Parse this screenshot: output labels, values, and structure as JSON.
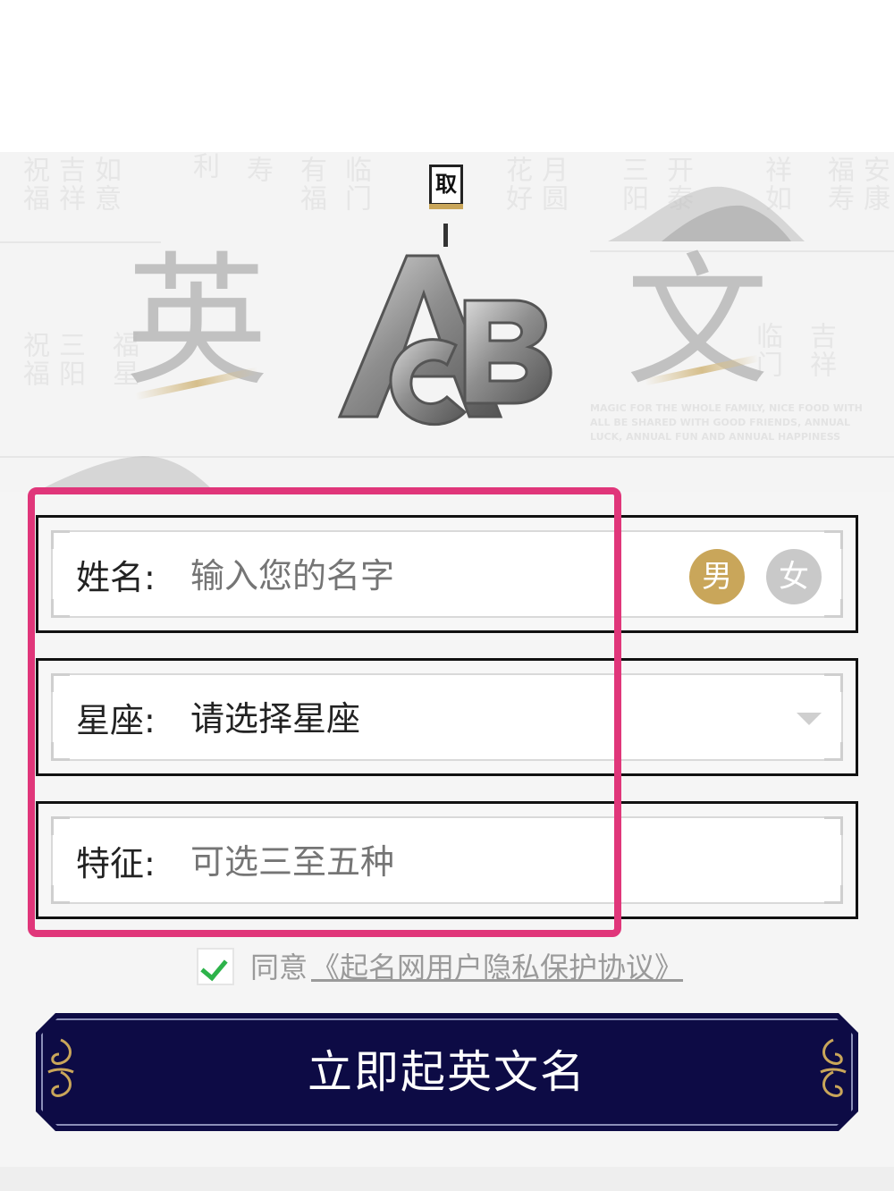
{
  "banner": {
    "seal_char": "取",
    "title_left": "英",
    "title_right": "文"
  },
  "form": {
    "name_label": "姓名:",
    "name_placeholder": "输入您的名字",
    "gender_male": "男",
    "gender_female": "女",
    "zodiac_label": "星座:",
    "zodiac_value": "请选择星座",
    "traits_label": "特征:",
    "traits_placeholder": "可选三至五种"
  },
  "agreement": {
    "prefix": "同意",
    "link": "《起名网用户隐私保护协议》",
    "checked": true
  },
  "submit_label": "立即起英文名",
  "colors": {
    "gold": "#c9a65a",
    "navy": "#0d0b45",
    "highlight": "#e0367a",
    "check": "#2db34a"
  }
}
